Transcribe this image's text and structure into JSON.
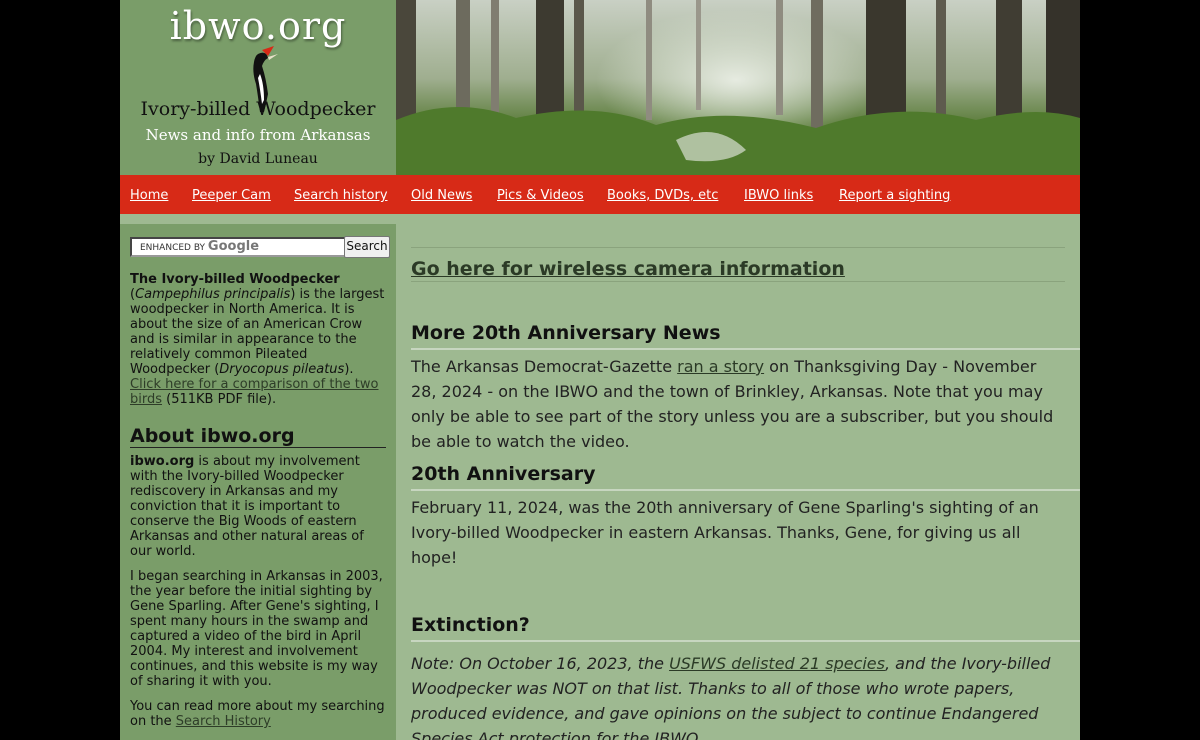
{
  "header": {
    "site_title": "ibwo.org",
    "bird_name": "Ivory-billed Woodpecker",
    "tagline": "News and info from Arkansas",
    "byline": "by David Luneau"
  },
  "nav": {
    "items": [
      {
        "label": "Home"
      },
      {
        "label": "Peeper Cam"
      },
      {
        "label": "Search history"
      },
      {
        "label": "Old News"
      },
      {
        "label": "Pics & Videos"
      },
      {
        "label": "Books, DVDs, etc"
      },
      {
        "label": "IBWO links"
      },
      {
        "label": "Report a sighting"
      }
    ]
  },
  "sidebar": {
    "search": {
      "placeholder_prefix": "ENHANCED BY",
      "placeholder_brand": "Google",
      "button_label": "Search"
    },
    "intro": {
      "bold": "The Ivory-billed Woodpecker",
      "paren_open": " (",
      "sci_name": "Campephilus principalis",
      "text_1": ") is the largest woodpecker in North America. It is about the size of an American Crow and is similar in appearance to the relatively common Pileated Woodpecker (",
      "sci_name_2": "Dryocopus pileatus",
      "text_2": ").",
      "link": "Click here for a comparison of the two birds",
      "text_3": " (511KB PDF file)."
    },
    "about_heading": "About ibwo.org",
    "about_p1_bold": "ibwo.org",
    "about_p1": " is about my involvement with the Ivory-billed Woodpecker rediscovery in Arkansas and my conviction that it is important to conserve the Big Woods of eastern Arkansas and other natural areas of our world.",
    "about_p2": "I began searching in Arkansas in 2003, the year before the initial sighting by Gene Sparling. After Gene's sighting, I spent many hours in the swamp and captured a video of the bird in April 2004. My interest and involvement continues, and this website is my way of sharing it with you.",
    "about_p3_text": "You can read more about my searching on the ",
    "about_p3_link": "Search History"
  },
  "main": {
    "camera_link": "Go here for wireless camera information",
    "sections": [
      {
        "title": "More 20th Anniversary News",
        "pre": "The Arkansas Democrat-Gazette ",
        "link": "ran a story",
        "post": " on Thanksgiving Day - November 28, 2024 - on the IBWO and the town of Brinkley, Arkansas. Note that you may only be able to see part of the story unless you are a subscriber, but you should be able to watch the video."
      },
      {
        "title": "20th Anniversary",
        "body": "February 11, 2024, was the 20th anniversary of Gene Sparling's sighting of an Ivory-billed Woodpecker in eastern Arkansas. Thanks, Gene, for giving us all hope!"
      },
      {
        "title": "Extinction?",
        "pre": "Note: On October 16, 2023, the ",
        "link": "USFWS delisted 21 species",
        "post": ", and the Ivory-billed Woodpecker was NOT on that list. Thanks to all of those who wrote papers, produced evidence, and gave opinions on the subject to continue Endangered Species Act protection for the IBWO."
      }
    ]
  },
  "colors": {
    "page_bg": "#9eb991",
    "sidebar_bg": "#7a9d69",
    "nav_bg": "#d72a17",
    "outer_bg": "#000000"
  }
}
